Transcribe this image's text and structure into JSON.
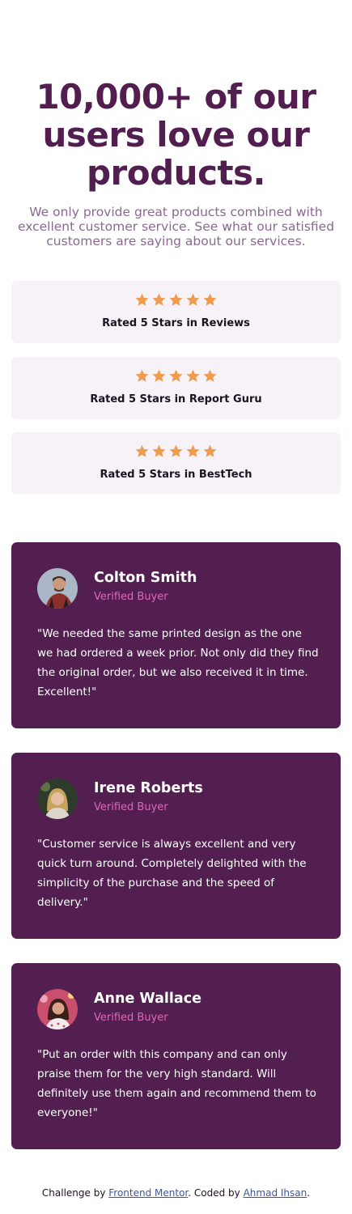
{
  "hero": {
    "title": "10,000+ of our users love our products.",
    "subtitle": "We only provide great products combined with excellent customer service. See what our satisfied customers are saying about our services."
  },
  "ratings": [
    {
      "label": "Rated 5 Stars in Reviews",
      "stars": 5
    },
    {
      "label": "Rated 5 Stars in Report Guru",
      "stars": 5
    },
    {
      "label": "Rated 5 Stars in BestTech",
      "stars": 5
    }
  ],
  "testimonials": [
    {
      "name": "Colton Smith",
      "status": "Verified Buyer",
      "quote": "\"We needed the same printed design as the one we had ordered a week prior. Not only did they find the original order, but we also received it in time. Excellent!\""
    },
    {
      "name": "Irene Roberts",
      "status": "Verified Buyer",
      "quote": "\"Customer service is always excellent and very quick turn around. Completely delighted with the simplicity of the purchase and the speed of delivery.\""
    },
    {
      "name": "Anne Wallace",
      "status": "Verified Buyer",
      "quote": "\"Put an order with this company and can only praise them for the very high standard. Will definitely use them again and recommend them to everyone!\""
    }
  ],
  "footer": {
    "prefix": "Challenge by ",
    "link1": "Frontend Mentor",
    "middle": ". Coded by ",
    "link2": "Ahmad Ihsan",
    "suffix": "."
  },
  "colors": {
    "primary": "#521f50",
    "accent": "#e067b8",
    "star": "#ef9c4f",
    "rating_bg": "#f6f2f8"
  },
  "icons": {
    "star": "star-icon"
  }
}
